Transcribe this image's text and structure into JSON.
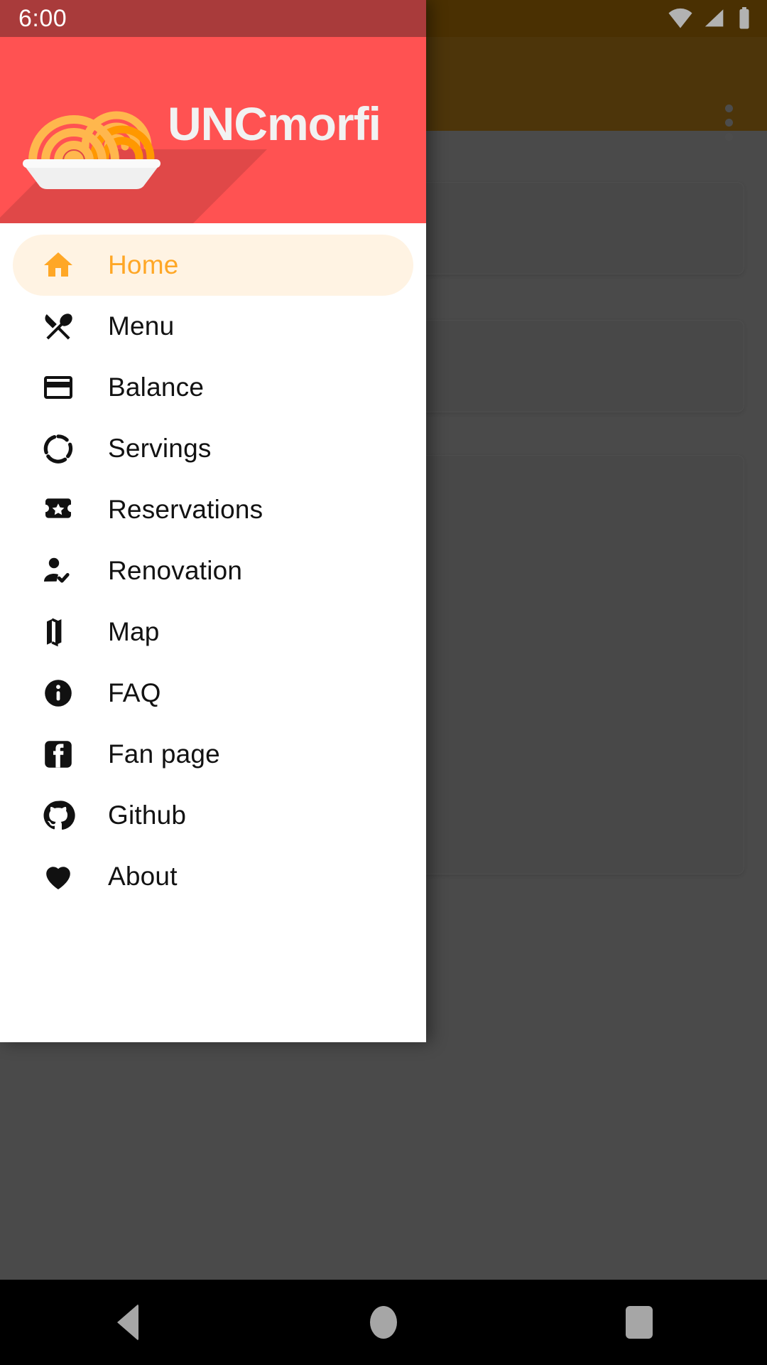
{
  "status_bar": {
    "clock": "6:00",
    "icons": [
      "wifi-icon",
      "cell-signal-icon",
      "battery-icon"
    ]
  },
  "background_app": {
    "overflow_menu_label": "More options",
    "cards": [
      "card-1",
      "card-2",
      "card-3"
    ],
    "appbar_color": "#6f4d0f",
    "scrim_color": "#6a6a6a"
  },
  "drawer": {
    "header": {
      "title": "UNCmorfi",
      "logo_name": "spaghetti-plate-logo",
      "background_color": "#ff5252",
      "title_color": "#f2f2f2"
    },
    "selected_item": "Home",
    "selected_color": "#ffa726",
    "selected_background": "#fff3e3",
    "items": [
      {
        "label": "Home",
        "icon": "home-icon",
        "selected": true
      },
      {
        "label": "Menu",
        "icon": "fork-spoon-icon",
        "selected": false
      },
      {
        "label": "Balance",
        "icon": "credit-card-icon",
        "selected": false
      },
      {
        "label": "Servings",
        "icon": "donut-large-icon",
        "selected": false
      },
      {
        "label": "Reservations",
        "icon": "ticket-star-icon",
        "selected": false
      },
      {
        "label": "Renovation",
        "icon": "person-check-icon",
        "selected": false
      },
      {
        "label": "Map",
        "icon": "map-icon",
        "selected": false
      },
      {
        "label": "FAQ",
        "icon": "info-icon",
        "selected": false
      },
      {
        "label": "Fan page",
        "icon": "facebook-icon",
        "selected": false
      },
      {
        "label": "Github",
        "icon": "github-icon",
        "selected": false
      },
      {
        "label": "About",
        "icon": "heart-icon",
        "selected": false
      }
    ]
  },
  "system_navbar": {
    "back_label": "Back",
    "home_label": "Home",
    "recents_label": "Recents"
  }
}
